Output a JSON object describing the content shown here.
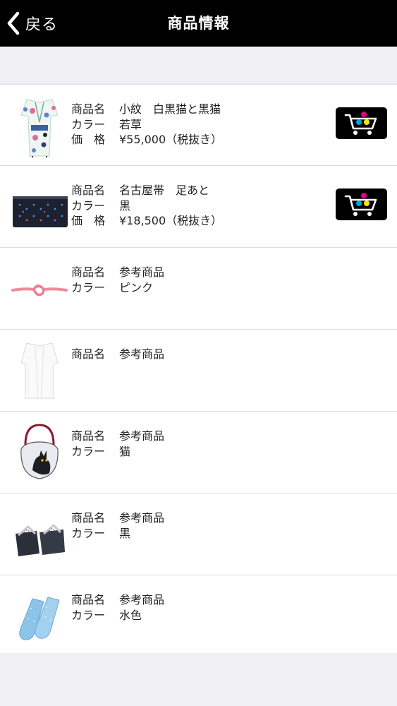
{
  "header": {
    "back_label": "戻る",
    "title": "商品情報"
  },
  "labels": {
    "name": "商品名",
    "color": "カラー",
    "price": "価　格"
  },
  "items": [
    {
      "name": "小紋　白黒猫と黒猫",
      "color": "若草",
      "price": "¥55,000（税抜き）",
      "thumb": "kimono-thumbnail",
      "cart": true
    },
    {
      "name": "名古屋帯　足あと",
      "color": "黒",
      "price": "¥18,500（税抜き）",
      "thumb": "obi-thumbnail",
      "cart": true
    },
    {
      "name": "参考商品",
      "color": "ピンク",
      "price": null,
      "thumb": "obijime-thumbnail",
      "cart": false
    },
    {
      "name": "参考商品",
      "color": null,
      "price": null,
      "thumb": "haori-thumbnail",
      "cart": false
    },
    {
      "name": "参考商品",
      "color": "猫",
      "price": null,
      "thumb": "cat-bag-thumbnail",
      "cart": false
    },
    {
      "name": "参考商品",
      "color": "黒",
      "price": null,
      "thumb": "geta-thumbnail",
      "cart": false
    },
    {
      "name": "参考商品",
      "color": "水色",
      "price": null,
      "thumb": "tabi-thumbnail",
      "cart": false
    }
  ],
  "colors": {
    "header_bg": "#000000",
    "page_bg": "#efeff4",
    "cart_magenta": "#e5007f",
    "cart_cyan": "#00a0e9",
    "cart_yellow": "#ffe100"
  }
}
